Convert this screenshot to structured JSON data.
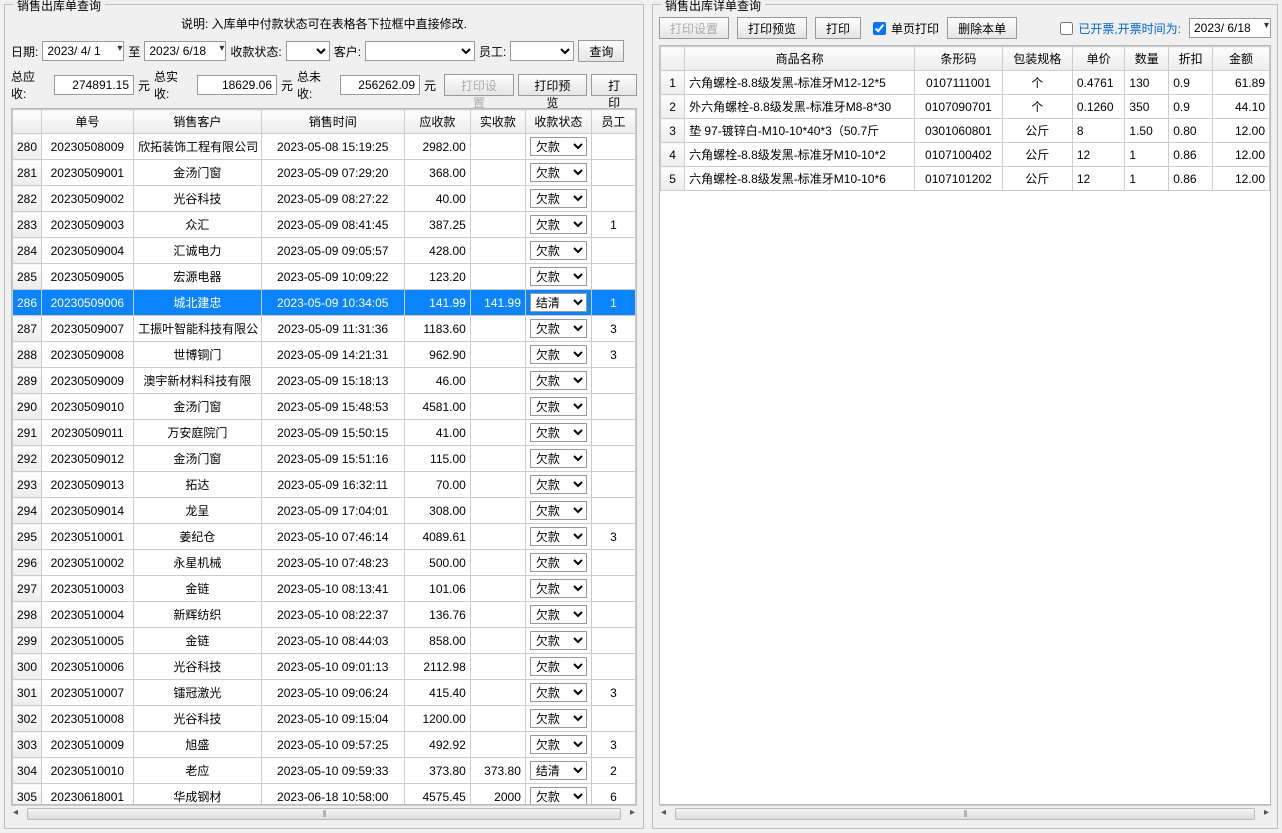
{
  "left": {
    "title": "销售出库单查询",
    "instruction": "说明: 入库单中付款状态可在表格各下拉框中直接修改.",
    "filters": {
      "date_label": "日期:",
      "date_from": "2023/ 4/ 1",
      "date_to_label": "至",
      "date_to": "2023/ 6/18",
      "status_label": "收款状态:",
      "customer_label": "客户:",
      "staff_label": "员工:",
      "query_btn": "查询"
    },
    "summary": {
      "total_receivable_label": "总应收:",
      "total_receivable": "274891.15",
      "unit": "元",
      "total_received_label": "总实收:",
      "total_received": "18629.06",
      "total_unreceived_label": "总未收:",
      "total_unreceived": "256262.09",
      "print_settings": "打印设置",
      "print_preview": "打印预览",
      "print": "打印"
    },
    "columns": [
      "",
      "单号",
      "销售客户",
      "销售时间",
      "应收款",
      "实收款",
      "收款状态",
      "员工"
    ],
    "rows": [
      {
        "idx": "280",
        "no": "20230508009",
        "cust": "欣拓装饰工程有限公司",
        "time": "2023-05-08 15:19:25",
        "due": "2982.00",
        "paid": "",
        "status": "欠款",
        "staff": ""
      },
      {
        "idx": "281",
        "no": "20230509001",
        "cust": "金汤门窗",
        "time": "2023-05-09 07:29:20",
        "due": "368.00",
        "paid": "",
        "status": "欠款",
        "staff": ""
      },
      {
        "idx": "282",
        "no": "20230509002",
        "cust": "光谷科技",
        "time": "2023-05-09 08:27:22",
        "due": "40.00",
        "paid": "",
        "status": "欠款",
        "staff": ""
      },
      {
        "idx": "283",
        "no": "20230509003",
        "cust": "众汇",
        "time": "2023-05-09 08:41:45",
        "due": "387.25",
        "paid": "",
        "status": "欠款",
        "staff": "1"
      },
      {
        "idx": "284",
        "no": "20230509004",
        "cust": "汇诚电力",
        "time": "2023-05-09 09:05:57",
        "due": "428.00",
        "paid": "",
        "status": "欠款",
        "staff": ""
      },
      {
        "idx": "285",
        "no": "20230509005",
        "cust": "宏源电器",
        "time": "2023-05-09 10:09:22",
        "due": "123.20",
        "paid": "",
        "status": "欠款",
        "staff": ""
      },
      {
        "idx": "286",
        "no": "20230509006",
        "cust": "城北建忠",
        "time": "2023-05-09 10:34:05",
        "due": "141.99",
        "paid": "141.99",
        "status": "结清",
        "staff": "1",
        "selected": true
      },
      {
        "idx": "287",
        "no": "20230509007",
        "cust": "工振叶智能科技有限公",
        "time": "2023-05-09 11:31:36",
        "due": "1183.60",
        "paid": "",
        "status": "欠款",
        "staff": "3"
      },
      {
        "idx": "288",
        "no": "20230509008",
        "cust": "世博铜门",
        "time": "2023-05-09 14:21:31",
        "due": "962.90",
        "paid": "",
        "status": "欠款",
        "staff": "3"
      },
      {
        "idx": "289",
        "no": "20230509009",
        "cust": "澳宇新材料科技有限",
        "time": "2023-05-09 15:18:13",
        "due": "46.00",
        "paid": "",
        "status": "欠款",
        "staff": ""
      },
      {
        "idx": "290",
        "no": "20230509010",
        "cust": "金汤门窗",
        "time": "2023-05-09 15:48:53",
        "due": "4581.00",
        "paid": "",
        "status": "欠款",
        "staff": ""
      },
      {
        "idx": "291",
        "no": "20230509011",
        "cust": "万安庭院门",
        "time": "2023-05-09 15:50:15",
        "due": "41.00",
        "paid": "",
        "status": "欠款",
        "staff": ""
      },
      {
        "idx": "292",
        "no": "20230509012",
        "cust": "金汤门窗",
        "time": "2023-05-09 15:51:16",
        "due": "115.00",
        "paid": "",
        "status": "欠款",
        "staff": ""
      },
      {
        "idx": "293",
        "no": "20230509013",
        "cust": "拓达",
        "time": "2023-05-09 16:32:11",
        "due": "70.00",
        "paid": "",
        "status": "欠款",
        "staff": ""
      },
      {
        "idx": "294",
        "no": "20230509014",
        "cust": "龙呈",
        "time": "2023-05-09 17:04:01",
        "due": "308.00",
        "paid": "",
        "status": "欠款",
        "staff": ""
      },
      {
        "idx": "295",
        "no": "20230510001",
        "cust": "姜纪仓",
        "time": "2023-05-10 07:46:14",
        "due": "4089.61",
        "paid": "",
        "status": "欠款",
        "staff": "3"
      },
      {
        "idx": "296",
        "no": "20230510002",
        "cust": "永星机械",
        "time": "2023-05-10 07:48:23",
        "due": "500.00",
        "paid": "",
        "status": "欠款",
        "staff": ""
      },
      {
        "idx": "297",
        "no": "20230510003",
        "cust": "金链",
        "time": "2023-05-10 08:13:41",
        "due": "101.06",
        "paid": "",
        "status": "欠款",
        "staff": ""
      },
      {
        "idx": "298",
        "no": "20230510004",
        "cust": "新辉纺织",
        "time": "2023-05-10 08:22:37",
        "due": "136.76",
        "paid": "",
        "status": "欠款",
        "staff": ""
      },
      {
        "idx": "299",
        "no": "20230510005",
        "cust": "金链",
        "time": "2023-05-10 08:44:03",
        "due": "858.00",
        "paid": "",
        "status": "欠款",
        "staff": ""
      },
      {
        "idx": "300",
        "no": "20230510006",
        "cust": "光谷科技",
        "time": "2023-05-10 09:01:13",
        "due": "2112.98",
        "paid": "",
        "status": "欠款",
        "staff": ""
      },
      {
        "idx": "301",
        "no": "20230510007",
        "cust": "镭冠激光",
        "time": "2023-05-10 09:06:24",
        "due": "415.40",
        "paid": "",
        "status": "欠款",
        "staff": "3"
      },
      {
        "idx": "302",
        "no": "20230510008",
        "cust": "光谷科技",
        "time": "2023-05-10 09:15:04",
        "due": "1200.00",
        "paid": "",
        "status": "欠款",
        "staff": ""
      },
      {
        "idx": "303",
        "no": "20230510009",
        "cust": "旭盛",
        "time": "2023-05-10 09:57:25",
        "due": "492.92",
        "paid": "",
        "status": "欠款",
        "staff": "3"
      },
      {
        "idx": "304",
        "no": "20230510010",
        "cust": "老应",
        "time": "2023-05-10 09:59:33",
        "due": "373.80",
        "paid": "373.80",
        "status": "结清",
        "staff": "2"
      },
      {
        "idx": "305",
        "no": "20230618001",
        "cust": "华成钢材",
        "time": "2023-06-18 10:58:00",
        "due": "4575.45",
        "paid": "2000",
        "status": "欠款",
        "staff": "6"
      }
    ]
  },
  "right": {
    "title": "销售出库详单查询",
    "toolbar": {
      "print_settings": "打印设置",
      "print_preview": "打印预览",
      "print": "打印",
      "single_page": "单页打印",
      "delete": "删除本单",
      "invoiced_label": "已开票,开票时间为:",
      "invoice_date": "2023/ 6/18"
    },
    "columns": [
      "",
      "商品名称",
      "条形码",
      "包装规格",
      "单价",
      "数量",
      "折扣",
      "金额"
    ],
    "rows": [
      {
        "idx": "1",
        "name": "六角螺栓-8.8级发黑-标准牙M12-12*5",
        "barcode": "0107111001",
        "spec": "个",
        "price": "0.4761",
        "qty": "130",
        "disc": "0.9",
        "amt": "61.89"
      },
      {
        "idx": "2",
        "name": "外六角螺栓-8.8级发黑-标准牙M8-8*30",
        "barcode": "0107090701",
        "spec": "个",
        "price": "0.1260",
        "qty": "350",
        "disc": "0.9",
        "amt": "44.10"
      },
      {
        "idx": "3",
        "name": "垫   97-镀锌白-M10-10*40*3（50.7斤",
        "barcode": "0301060801",
        "spec": "公斤",
        "price": "8",
        "qty": "1.50",
        "disc": "0.80",
        "amt": "12.00"
      },
      {
        "idx": "4",
        "name": "六角螺栓-8.8级发黑-标准牙M10-10*2",
        "barcode": "0107100402",
        "spec": "公斤",
        "price": "12",
        "qty": "1",
        "disc": "0.86",
        "amt": "12.00"
      },
      {
        "idx": "5",
        "name": "六角螺栓-8.8级发黑-标准牙M10-10*6",
        "barcode": "0107101202",
        "spec": "公斤",
        "price": "12",
        "qty": "1",
        "disc": "0.86",
        "amt": "12.00"
      }
    ]
  }
}
